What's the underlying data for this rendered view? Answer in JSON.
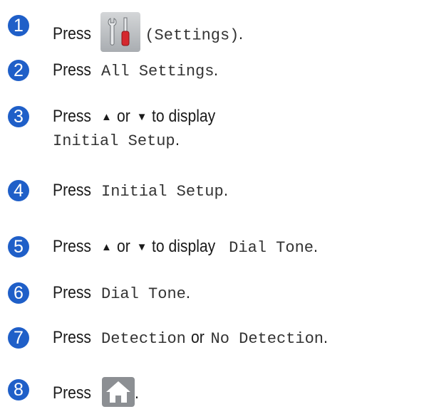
{
  "steps": [
    {
      "num": "1",
      "press": "Press",
      "code": "(Settings)",
      "end": ".",
      "icon": "settings-icon"
    },
    {
      "num": "2",
      "press": "Press",
      "code": "All Settings",
      "end": "."
    },
    {
      "num": "3",
      "press": "Press",
      "up": "▲",
      "or": "or",
      "down": "▼",
      "text": "to display",
      "code": "Initial Setup",
      "end": "."
    },
    {
      "num": "4",
      "press": "Press",
      "code": "Initial Setup",
      "end": "."
    },
    {
      "num": "5",
      "press": "Press",
      "up": "▲",
      "or": "or",
      "down": "▼",
      "text": "to display",
      "code": "Dial Tone",
      "end": "."
    },
    {
      "num": "6",
      "press": "Press",
      "code": "Dial Tone",
      "end": "."
    },
    {
      "num": "7",
      "press": "Press",
      "code1": "Detection",
      "or": "or",
      "code2": "No Detection",
      "end": "."
    },
    {
      "num": "8",
      "press": "Press",
      "end": ".",
      "icon": "home-icon"
    }
  ],
  "colors": {
    "step_circle": "#1f5fc8",
    "text": "#1a1a1a"
  }
}
